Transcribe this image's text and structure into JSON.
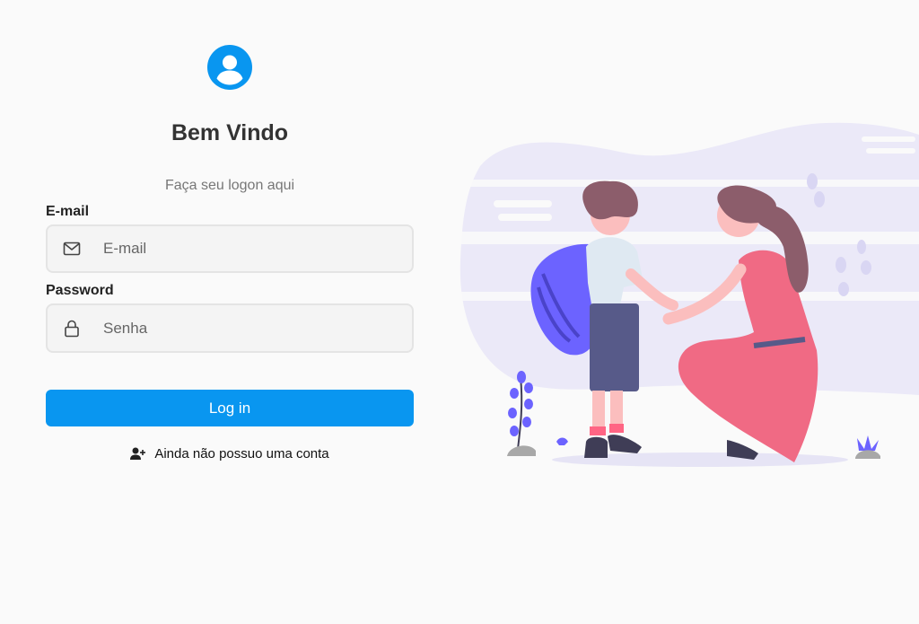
{
  "header": {
    "avatar_icon": "user-circle-icon",
    "title": "Bem Vindo",
    "subtitle": "Faça seu logon aqui"
  },
  "form": {
    "email_label": "E-mail",
    "email_placeholder": "E-mail",
    "email_value": "",
    "email_icon": "envelope-icon",
    "password_label": "Password",
    "password_placeholder": "Senha",
    "password_value": "",
    "password_icon": "lock-icon",
    "login_label": "Log in"
  },
  "signup": {
    "icon": "user-plus-icon",
    "label": "Ainda não possuo uma conta"
  },
  "illustration": {
    "description_icon": "mother-and-child-illustration"
  },
  "colors": {
    "accent": "#0996f0",
    "background": "#fafafa",
    "illustration_purple": "#6c63ff",
    "illustration_pink": "#f06a84"
  }
}
